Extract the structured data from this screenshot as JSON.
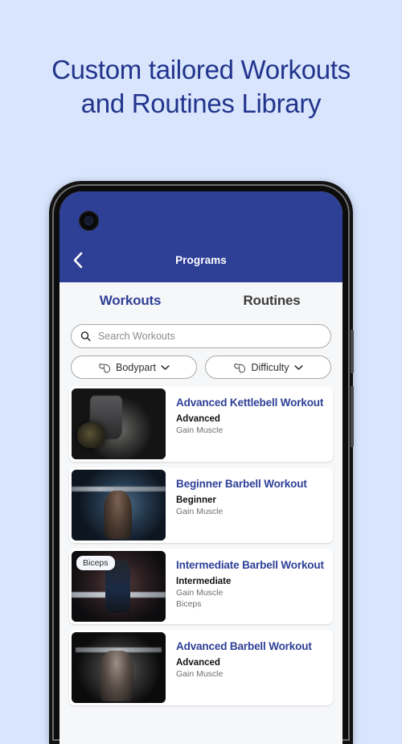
{
  "headline": {
    "line1": "Custom tailored Workouts",
    "line2": "and Routines Library"
  },
  "colors": {
    "page_background": "#d8e5fd",
    "brand_blue": "#2e3f96",
    "screen_background": "#f6f7f9",
    "card_background": "#ffffff",
    "title_blue": "#2e3f96",
    "muted_text": "#6f6f6f"
  },
  "phone": {
    "app_header": {
      "back_icon": "chevron-left-icon",
      "title": "Programs"
    },
    "tabs": [
      {
        "label": "Workouts",
        "active": true
      },
      {
        "label": "Routines",
        "active": false
      }
    ],
    "search": {
      "icon": "search-icon",
      "placeholder": "Search Workouts",
      "value": ""
    },
    "filters": [
      {
        "icon": "bicep-icon",
        "label": "Bodypart",
        "chevron": "chevron-down-icon"
      },
      {
        "icon": "bicep-icon",
        "label": "Difficulty",
        "chevron": "chevron-down-icon"
      }
    ],
    "cards": [
      {
        "title": "Advanced Kettlebell Workout",
        "level": "Advanced",
        "goal": "Gain Muscle",
        "bodypart": "",
        "badge": "",
        "thumb": "kettlebell"
      },
      {
        "title": "Beginner Barbell Workout",
        "level": "Beginner",
        "goal": "Gain Muscle",
        "bodypart": "",
        "badge": "",
        "thumb": "barbell-front-squat"
      },
      {
        "title": "Intermediate Barbell Workout",
        "level": "Intermediate",
        "goal": "Gain Muscle",
        "bodypart": "Biceps",
        "badge": "Biceps",
        "thumb": "deadlift"
      },
      {
        "title": "Advanced Barbell Workout",
        "level": "Advanced",
        "goal": "Gain Muscle",
        "bodypart": "",
        "badge": "",
        "thumb": "squat"
      }
    ]
  }
}
